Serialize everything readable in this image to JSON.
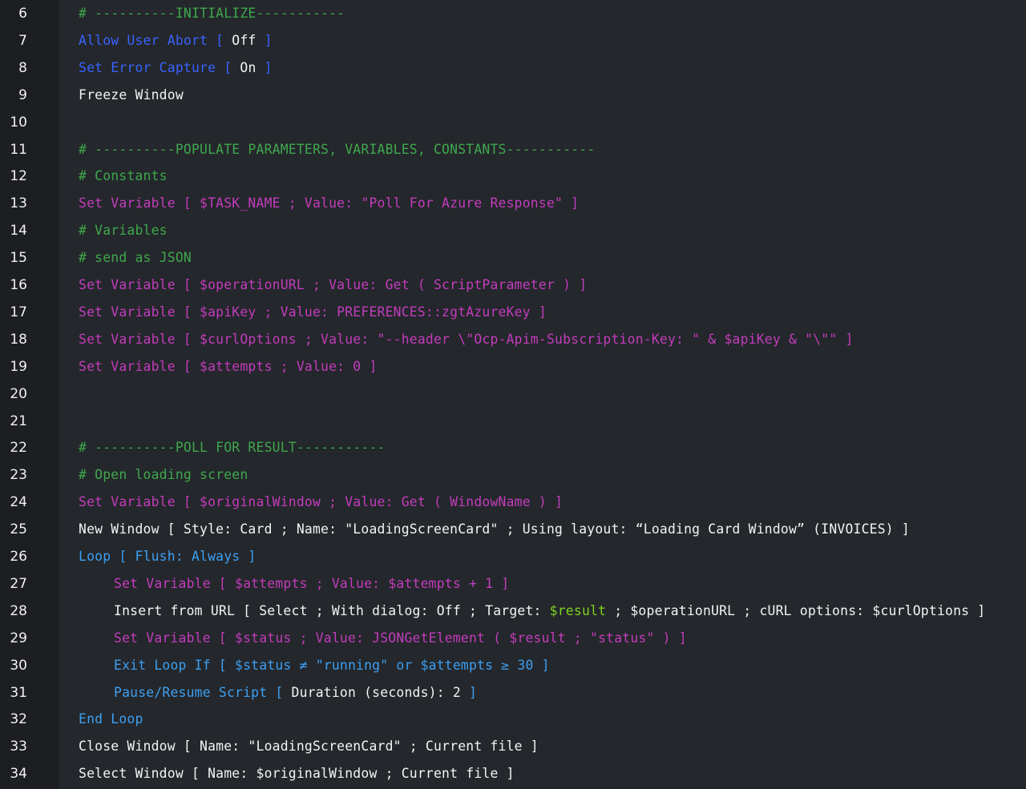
{
  "editor": {
    "lines": [
      {
        "num": "6",
        "indent": 0,
        "tokens": [
          {
            "t": "# ----------INITIALIZE-----------",
            "c": "comment"
          }
        ]
      },
      {
        "num": "7",
        "indent": 0,
        "tokens": [
          {
            "t": "Allow User Abort [ ",
            "c": "blue"
          },
          {
            "t": "Off",
            "c": "white"
          },
          {
            "t": " ]",
            "c": "blue"
          }
        ]
      },
      {
        "num": "8",
        "indent": 0,
        "tokens": [
          {
            "t": "Set Error Capture [ ",
            "c": "blue"
          },
          {
            "t": "On",
            "c": "white"
          },
          {
            "t": " ]",
            "c": "blue"
          }
        ]
      },
      {
        "num": "9",
        "indent": 0,
        "tokens": [
          {
            "t": "Freeze Window",
            "c": "white"
          }
        ]
      },
      {
        "num": "10",
        "indent": 0,
        "tokens": []
      },
      {
        "num": "11",
        "indent": 0,
        "tokens": [
          {
            "t": "# ----------POPULATE PARAMETERS, VARIABLES, CONSTANTS-----------",
            "c": "comment"
          }
        ]
      },
      {
        "num": "12",
        "indent": 0,
        "tokens": [
          {
            "t": "# Constants",
            "c": "comment"
          }
        ]
      },
      {
        "num": "13",
        "indent": 0,
        "tokens": [
          {
            "t": "Set Variable [ $TASK_NAME ; Value: \"Poll For Azure Response\" ]",
            "c": "magenta"
          }
        ]
      },
      {
        "num": "14",
        "indent": 0,
        "tokens": [
          {
            "t": "# Variables",
            "c": "comment"
          }
        ]
      },
      {
        "num": "15",
        "indent": 0,
        "tokens": [
          {
            "t": "# send as JSON",
            "c": "comment"
          }
        ]
      },
      {
        "num": "16",
        "indent": 0,
        "tokens": [
          {
            "t": "Set Variable [ $operationURL ; Value: Get ( ScriptParameter ) ]",
            "c": "magenta"
          }
        ]
      },
      {
        "num": "17",
        "indent": 0,
        "tokens": [
          {
            "t": "Set Variable [ $apiKey ; Value: PREFERENCES::zgtAzureKey ]",
            "c": "magenta"
          }
        ]
      },
      {
        "num": "18",
        "indent": 0,
        "tokens": [
          {
            "t": "Set Variable [ $curlOptions ; Value: \"--header \\\"Ocp-Apim-Subscription-Key: \" & $apiKey & \"\\\"\" ]",
            "c": "magenta"
          }
        ]
      },
      {
        "num": "19",
        "indent": 0,
        "tokens": [
          {
            "t": "Set Variable [ $attempts ; Value: 0 ]",
            "c": "magenta"
          }
        ]
      },
      {
        "num": "20",
        "indent": 0,
        "tokens": []
      },
      {
        "num": "21",
        "indent": 0,
        "tokens": []
      },
      {
        "num": "22",
        "indent": 0,
        "tokens": [
          {
            "t": "# ----------POLL FOR RESULT-----------",
            "c": "comment"
          }
        ]
      },
      {
        "num": "23",
        "indent": 0,
        "tokens": [
          {
            "t": "# Open loading screen",
            "c": "comment"
          }
        ]
      },
      {
        "num": "24",
        "indent": 0,
        "tokens": [
          {
            "t": "Set Variable [ $originalWindow ; Value: Get ( WindowName ) ]",
            "c": "magenta"
          }
        ]
      },
      {
        "num": "25",
        "indent": 0,
        "tokens": [
          {
            "t": "New Window [ Style: Card ; Name: \"LoadingScreenCard\" ; Using layout: “Loading Card Window” (INVOICES) ]",
            "c": "white"
          }
        ]
      },
      {
        "num": "26",
        "indent": 0,
        "tokens": [
          {
            "t": "Loop [ Flush: Always ]",
            "c": "cyan"
          }
        ]
      },
      {
        "num": "27",
        "indent": 1,
        "tokens": [
          {
            "t": "Set Variable [ $attempts ; Value: $attempts + 1 ]",
            "c": "magenta"
          }
        ]
      },
      {
        "num": "28",
        "indent": 1,
        "tokens": [
          {
            "t": "Insert from URL [ Select ; With dialog: Off ; Target: ",
            "c": "white"
          },
          {
            "t": "$result",
            "c": "green"
          },
          {
            "t": " ; $operationURL ; cURL options: $curlOptions ]",
            "c": "white"
          }
        ]
      },
      {
        "num": "29",
        "indent": 1,
        "tokens": [
          {
            "t": "Set Variable [ $status ; Value: JSONGetElement ( $result ; \"status\" ) ]",
            "c": "magenta"
          }
        ]
      },
      {
        "num": "30",
        "indent": 1,
        "tokens": [
          {
            "t": "Exit Loop If [ $status ≠ \"running\" or $attempts ≥ 30 ]",
            "c": "cyan"
          }
        ]
      },
      {
        "num": "31",
        "indent": 1,
        "tokens": [
          {
            "t": "Pause/Resume Script [ ",
            "c": "cyan"
          },
          {
            "t": "Duration (seconds): 2",
            "c": "white"
          },
          {
            "t": " ]",
            "c": "cyan"
          }
        ]
      },
      {
        "num": "32",
        "indent": 0,
        "tokens": [
          {
            "t": "End Loop",
            "c": "cyan"
          }
        ]
      },
      {
        "num": "33",
        "indent": 0,
        "tokens": [
          {
            "t": "Close Window [ Name: \"LoadingScreenCard\" ; Current file ]",
            "c": "white"
          }
        ]
      },
      {
        "num": "34",
        "indent": 0,
        "tokens": [
          {
            "t": "Select Window [ Name: $originalWindow ; Current file ]",
            "c": "white"
          }
        ]
      }
    ]
  }
}
